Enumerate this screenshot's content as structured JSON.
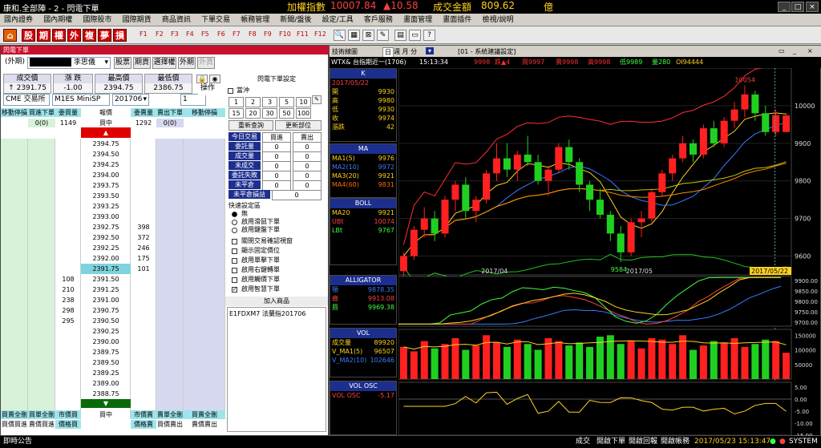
{
  "titlebar": {
    "app": "康和.全部陣 - 2 - 閃電下單",
    "index_label": "加權指數",
    "index_value": "10007.84",
    "index_change": "▲10.58",
    "amount_label": "成交金額",
    "amount_value": "809.62",
    "amount_unit": "億"
  },
  "menu": [
    "國內證券",
    "國內期權",
    "國際股市",
    "國際期貨",
    "商品資訊",
    "下單交易",
    "帳務管理",
    "新聞/盤後",
    "設定/工具",
    "客戶服務",
    "畫面管理",
    "畫面插件",
    "檢視/說明"
  ],
  "toolbar": {
    "hot": [
      "股",
      "期",
      "權",
      "外",
      "複",
      "夢",
      "損"
    ],
    "fkeys": [
      "F1",
      "F2",
      "F3",
      "F4",
      "F5",
      "F6",
      "F7",
      "F8",
      "F9",
      "F10",
      "F11",
      "F12"
    ]
  },
  "flash": {
    "title": "閃電下單",
    "account_type": "(外期)",
    "account_name": "李思儀",
    "btn_stock": "股票",
    "btn_fut": "期貨",
    "btn_opt": "選擇權",
    "btn_foreign": "外期",
    "btn_foreign2": "外貨",
    "quote": {
      "h1": "成交價",
      "v1": "↑ 2391.75",
      "h2": "漲 跌",
      "v2": "-1.00",
      "h3": "最高價",
      "v3": "2394.75",
      "h4": "最低價",
      "v4": "2386.75"
    },
    "exchange": "CME 交易所",
    "symbol": "M1ES  MiniSP",
    "month": "201706",
    "qty": "1",
    "btn_op": "操作",
    "head": [
      "移動停損",
      "買進下單",
      "委買量",
      "報價",
      "委賣量",
      "賣出下單",
      "移動停損"
    ],
    "subhead": {
      "buy_order": "0(0)",
      "buy_qty": "1149",
      "price": "買中",
      "sell_qty": "1292",
      "sell_order": "0(0)"
    },
    "up_arrow": "▲",
    "down_arrow": "▼",
    "rows": [
      {
        "p": "2394.75",
        "b": "",
        "s": ""
      },
      {
        "p": "2394.50",
        "b": "",
        "s": ""
      },
      {
        "p": "2394.25",
        "b": "",
        "s": ""
      },
      {
        "p": "2394.00",
        "b": "",
        "s": ""
      },
      {
        "p": "2393.75",
        "b": "",
        "s": ""
      },
      {
        "p": "2393.50",
        "b": "",
        "s": ""
      },
      {
        "p": "2393.25",
        "b": "",
        "s": ""
      },
      {
        "p": "2393.00",
        "b": "",
        "s": ""
      },
      {
        "p": "2392.75",
        "b": "",
        "s": "398"
      },
      {
        "p": "2392.50",
        "b": "",
        "s": "372"
      },
      {
        "p": "2392.25",
        "b": "",
        "s": "246"
      },
      {
        "p": "2392.00",
        "b": "",
        "s": "175"
      },
      {
        "p": "2391.75",
        "b": "",
        "s": "101"
      },
      {
        "p": "2391.50",
        "b": "108",
        "s": ""
      },
      {
        "p": "2391.25",
        "b": "210",
        "s": ""
      },
      {
        "p": "2391.00",
        "b": "238",
        "s": ""
      },
      {
        "p": "2390.75",
        "b": "298",
        "s": ""
      },
      {
        "p": "2390.50",
        "b": "295",
        "s": ""
      },
      {
        "p": "2390.25",
        "b": "",
        "s": ""
      },
      {
        "p": "2390.00",
        "b": "",
        "s": ""
      },
      {
        "p": "2389.75",
        "b": "",
        "s": ""
      },
      {
        "p": "2389.50",
        "b": "",
        "s": ""
      },
      {
        "p": "2389.25",
        "b": "",
        "s": ""
      },
      {
        "p": "2389.00",
        "b": "",
        "s": ""
      },
      {
        "p": "2388.75",
        "b": "",
        "s": ""
      }
    ],
    "current_price": "2391.75",
    "foot1": [
      "買賣全刪",
      "買單全刪",
      "市價買",
      "",
      "買中",
      "市價賣",
      "賣單全刪",
      "買賣全刪"
    ],
    "foot2": [
      "買價買進",
      "賣價買進",
      "價格買",
      "",
      "",
      "價格賣",
      "買價賣出",
      "賣價賣出"
    ]
  },
  "orderset": {
    "title": "閃電下單設定",
    "clear": "當沖",
    "qtys": [
      "1",
      "2",
      "3",
      "5",
      "10",
      "15",
      "20",
      "30",
      "50",
      "100"
    ],
    "reset": "重新查詢",
    "refresh": "更新部位",
    "table_head": [
      "今日交易",
      "買進",
      "賣出"
    ],
    "table_rows": [
      {
        "l": "委託量",
        "b": "0",
        "s": "0"
      },
      {
        "l": "成交量",
        "b": "0",
        "s": "0"
      },
      {
        "l": "未成交",
        "b": "0",
        "s": "0"
      },
      {
        "l": "委託失敗",
        "b": "0",
        "s": "0"
      },
      {
        "l": "未平倉",
        "b": "0",
        "s": "0"
      },
      {
        "l": "未平倉損益",
        "b": "0",
        "s": ""
      }
    ],
    "quick_title": "快速設定區",
    "radios": [
      "無",
      "啟用滑鼠下單",
      "啟用鍵盤下單"
    ],
    "checks": [
      {
        "l": "關閉交易確認視窗",
        "c": false
      },
      {
        "l": "顯示固定價位",
        "c": false
      },
      {
        "l": "啟用單擊下單",
        "c": false
      },
      {
        "l": "啟用右鍵轉單",
        "c": false
      },
      {
        "l": "啟用觸價下單",
        "c": false
      },
      {
        "l": "啟用智慧下單",
        "c": true
      }
    ],
    "add_title": "加入商品",
    "add_item": "E1FDXM7 法蘭指201706"
  },
  "chart": {
    "win_title": "技術線圖",
    "period_btn": "日",
    "period_sel": "週 月 分",
    "system": "[01 - 系統建議設定]",
    "info": {
      "sym": "WTX& 台指期近一(1706)",
      "time": "15:13:34",
      "price": "9998",
      "chg": "跌▲4",
      "buy": "買9997",
      "sell": "賣9998",
      "high": "高9998",
      "low": "低9989",
      "qty": "量280",
      "oi": "OI94444"
    },
    "k": {
      "title": "K",
      "date": "2017/05/22",
      "rows": [
        {
          "l": "開",
          "v": "9930"
        },
        {
          "l": "高",
          "v": "9980"
        },
        {
          "l": "低",
          "v": "9930"
        },
        {
          "l": "收",
          "v": "9974"
        },
        {
          "l": "漲跌",
          "v": "42"
        }
      ]
    },
    "ma": {
      "title": "MA",
      "rows": [
        {
          "l": "MA1(5)",
          "v": "9976"
        },
        {
          "l": "MA2(10)",
          "v": "9972"
        },
        {
          "l": "MA3(20)",
          "v": "9921"
        },
        {
          "l": "MA4(60)",
          "v": "9831"
        }
      ]
    },
    "boll": {
      "title": "BOLL",
      "rows": [
        {
          "l": "MA20",
          "v": "9921"
        },
        {
          "l": "UBt",
          "v": "10074"
        },
        {
          "l": "LBt",
          "v": "9767"
        }
      ]
    },
    "alligator": {
      "title": "ALLIGATOR",
      "rows": [
        {
          "l": "顎",
          "v": "9878.35"
        },
        {
          "l": "齒",
          "v": "9913.08"
        },
        {
          "l": "唇",
          "v": "9969.38"
        }
      ]
    },
    "vol": {
      "title": "VOL",
      "rows": [
        {
          "l": "成交量",
          "v": "89920"
        },
        {
          "l": "V_MA1(5)",
          "v": "96507"
        },
        {
          "l": "V_MA2(10)",
          "v": "102646"
        }
      ]
    },
    "volosc": {
      "title": "VOL OSC",
      "rows": [
        {
          "l": "VOL OSC",
          "v": "-5.17"
        }
      ]
    },
    "price_axis": [
      "10000",
      "9900",
      "9800",
      "9700",
      "9600"
    ],
    "alli_axis": [
      "9900.00",
      "9850.00",
      "9800.00",
      "9750.00",
      "9700.00"
    ],
    "vol_axis": [
      "150000",
      "100000",
      "50000"
    ],
    "osc_axis": [
      "5.00",
      "0.00",
      "-5.00",
      "-10.00",
      "-15.00"
    ],
    "date_labels": [
      "2017/04",
      "2017/05",
      "2017/05/22"
    ],
    "high_label": "10054",
    "low_label": "9584"
  },
  "chart_data": {
    "type": "candlestick",
    "ohlc": [
      [
        9560,
        9610,
        9540,
        9600
      ],
      [
        9600,
        9680,
        9590,
        9670
      ],
      [
        9670,
        9730,
        9650,
        9700
      ],
      [
        9700,
        9720,
        9640,
        9660
      ],
      [
        9660,
        9760,
        9650,
        9750
      ],
      [
        9750,
        9800,
        9720,
        9790
      ],
      [
        9790,
        9810,
        9700,
        9720
      ],
      [
        9720,
        9760,
        9690,
        9750
      ],
      [
        9750,
        9830,
        9740,
        9820
      ],
      [
        9820,
        9900,
        9800,
        9860
      ],
      [
        9860,
        9900,
        9810,
        9830
      ],
      [
        9830,
        9880,
        9800,
        9870
      ],
      [
        9870,
        9920,
        9840,
        9850
      ],
      [
        9850,
        9870,
        9790,
        9800
      ],
      [
        9800,
        9840,
        9760,
        9830
      ],
      [
        9830,
        9900,
        9820,
        9890
      ],
      [
        9890,
        9910,
        9830,
        9850
      ],
      [
        9850,
        9860,
        9770,
        9790
      ],
      [
        9790,
        9800,
        9720,
        9750
      ],
      [
        9750,
        9780,
        9700,
        9710
      ],
      [
        9710,
        9720,
        9640,
        9660
      ],
      [
        9660,
        9680,
        9584,
        9610
      ],
      [
        9610,
        9700,
        9600,
        9690
      ],
      [
        9690,
        9720,
        9650,
        9700
      ],
      [
        9700,
        9780,
        9690,
        9770
      ],
      [
        9770,
        9830,
        9760,
        9820
      ],
      [
        9820,
        9870,
        9800,
        9860
      ],
      [
        9860,
        9920,
        9850,
        9900
      ],
      [
        9900,
        9910,
        9850,
        9870
      ],
      [
        9870,
        9950,
        9860,
        9940
      ],
      [
        9940,
        9960,
        9890,
        9900
      ],
      [
        9900,
        9970,
        9890,
        9960
      ],
      [
        9960,
        10010,
        9940,
        9990
      ],
      [
        9990,
        10054,
        9970,
        10030
      ],
      [
        10030,
        10040,
        9960,
        9980
      ],
      [
        9980,
        10000,
        9920,
        9930
      ],
      [
        9930,
        9990,
        9920,
        9975
      ],
      [
        9930,
        9980,
        9930,
        9974
      ]
    ],
    "vol": [
      110,
      95,
      130,
      105,
      120,
      140,
      100,
      115,
      150,
      125,
      110,
      135,
      120,
      100,
      140,
      130,
      115,
      125,
      110,
      145,
      150,
      120,
      130,
      105,
      140,
      135,
      120,
      150,
      100,
      115,
      130,
      125,
      140,
      110,
      120,
      135,
      130,
      90
    ],
    "ylim": [
      9550,
      10100
    ],
    "xlabel": "",
    "ylabel": ""
  },
  "status": {
    "left": "即時公告",
    "items": [
      "成交",
      "開啟下單",
      "開啟回報",
      "開啟帳務"
    ],
    "time": "2017/05/23 15:13:47",
    "sys": "SYSTEM"
  }
}
